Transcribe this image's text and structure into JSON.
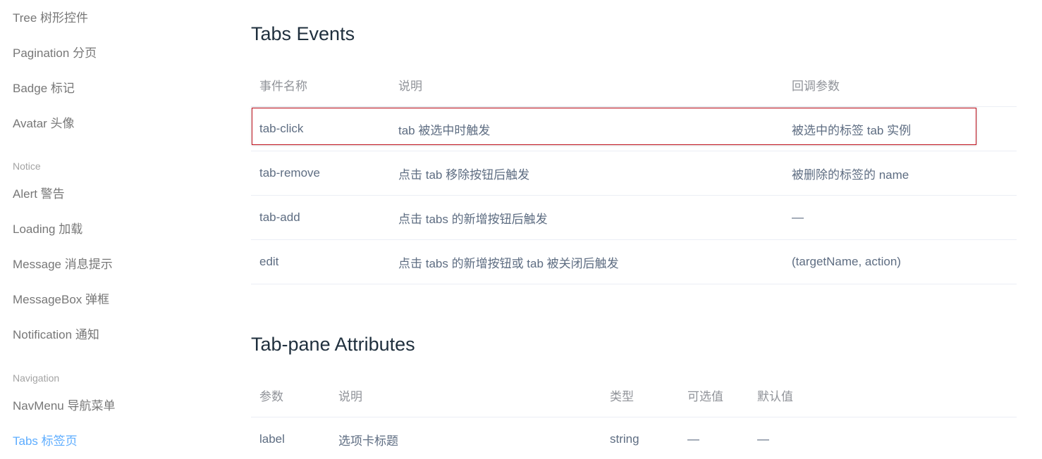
{
  "sidebar": {
    "items": [
      {
        "label": "Tree 树形控件"
      },
      {
        "label": "Pagination 分页"
      },
      {
        "label": "Badge 标记"
      },
      {
        "label": "Avatar 头像"
      }
    ],
    "groups": [
      {
        "title": "Notice",
        "items": [
          {
            "label": "Alert 警告"
          },
          {
            "label": "Loading 加载"
          },
          {
            "label": "Message 消息提示"
          },
          {
            "label": "MessageBox 弹框"
          },
          {
            "label": "Notification 通知"
          }
        ]
      },
      {
        "title": "Navigation",
        "items": [
          {
            "label": "NavMenu 导航菜单"
          },
          {
            "label": "Tabs 标签页",
            "active": true
          }
        ]
      }
    ]
  },
  "events_section": {
    "title": "Tabs Events",
    "headers": [
      "事件名称",
      "说明",
      "回调参数"
    ],
    "rows": [
      {
        "name": "tab-click",
        "desc": "tab 被选中时触发",
        "params": "被选中的标签 tab 实例",
        "highlighted": true
      },
      {
        "name": "tab-remove",
        "desc": "点击 tab 移除按钮后触发",
        "params": "被删除的标签的 name"
      },
      {
        "name": "tab-add",
        "desc": "点击 tabs 的新增按钮后触发",
        "params": "—"
      },
      {
        "name": "edit",
        "desc": "点击 tabs 的新增按钮或 tab 被关闭后触发",
        "params": "(targetName, action)"
      }
    ]
  },
  "attributes_section": {
    "title": "Tab-pane Attributes",
    "headers": [
      "参数",
      "说明",
      "类型",
      "可选值",
      "默认值"
    ],
    "rows": [
      {
        "param": "label",
        "desc": "选项卡标题",
        "type": "string",
        "options": "—",
        "default": "—"
      }
    ]
  },
  "colors": {
    "active_link": "#409eff",
    "highlight_border": "#c1121f",
    "row_border": "#ebeef5"
  }
}
